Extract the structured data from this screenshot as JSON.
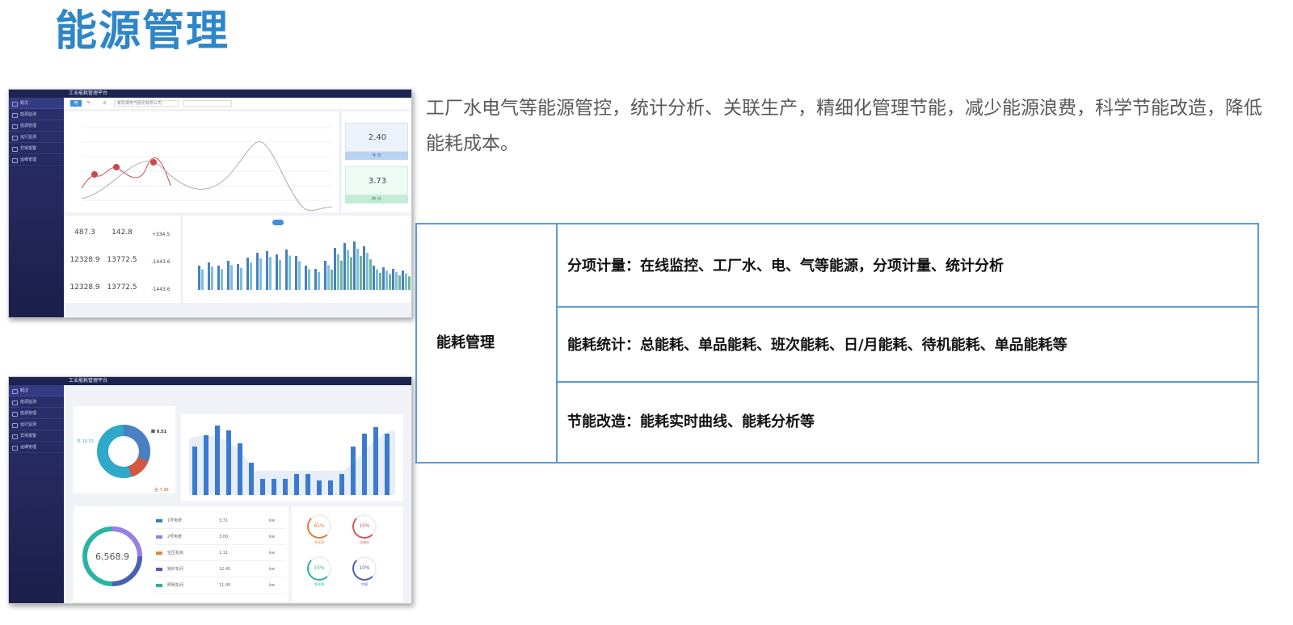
{
  "page": {
    "title": "能源管理",
    "intro": "工厂水电气等能源管控，统计分析、关联生产，精细化管理节能，减少能源浪费，科学节能改造，降低能耗成本。"
  },
  "table": {
    "category": "能耗管理",
    "rows": [
      "分项计量：在线监控、工厂水、电、气等能源，分项计量、统计分析",
      "能耗统计：总能耗、单品能耗、班次能耗、日/月能耗、待机能耗、单品能耗等",
      "节能改造：能耗实时曲线、能耗分析等"
    ]
  },
  "screenshot1": {
    "app_title": "工业能耗管理平台",
    "sidebar": [
      "概况",
      "能源监测",
      "能源管理",
      "运行监测",
      "异常报警",
      "运维管理"
    ],
    "tabs": [
      "电",
      "气",
      "水"
    ],
    "company_select": "某机械电气股份有限公司",
    "kpi_side": [
      {
        "value": "2.40",
        "label": "今 日"
      },
      {
        "value": "3.73",
        "label": "昨 日"
      }
    ],
    "kpis": [
      {
        "value": "487.3"
      },
      {
        "value": "142.8"
      },
      {
        "value": "+334.5"
      },
      {
        "value": "12328.9"
      },
      {
        "value": "13772.5"
      },
      {
        "value": "-1443.6"
      },
      {
        "value": "12328.9"
      },
      {
        "value": "13772.5"
      },
      {
        "value": "-1443.6"
      }
    ],
    "bar_colors": [
      "#4a7fc1",
      "#7ac0dc",
      "#6db58f"
    ],
    "line_color": "#c94a4a",
    "line2_color": "#b9a9a9"
  },
  "screenshot2": {
    "app_title": "工业能耗管理平台",
    "sidebar": [
      "概况",
      "能源监测",
      "能源管理",
      "运行监测",
      "异常报警",
      "运维管理"
    ],
    "donut_labels": [
      "峰 0.51",
      "平 10.51",
      "谷 7.96"
    ],
    "gauge_total": "6,568.9",
    "legend": [
      {
        "name": "1号电表",
        "value": "3.31",
        "unit": "kw",
        "color": "#2f7fc4"
      },
      {
        "name": "2号电表",
        "value": "3.00",
        "unit": "kw",
        "color": "#9a7fe0"
      },
      {
        "name": "空压机房",
        "value": "1.11",
        "unit": "kw",
        "color": "#e0893a"
      },
      {
        "name": "锅炉车间",
        "value": "12.45",
        "unit": "kw",
        "color": "#4a60b0"
      },
      {
        "name": "照明车间",
        "value": "11.00",
        "unit": "kw",
        "color": "#2ab3a0"
      }
    ],
    "rings": [
      {
        "value": "65%",
        "label": "空压机",
        "color": "#e07c3a"
      },
      {
        "value": "10%",
        "label": "注塑机",
        "color": "#d15a5a"
      },
      {
        "value": "15%",
        "label": "喷涂线",
        "color": "#2ab3a0"
      },
      {
        "value": "10%",
        "label": "空调",
        "color": "#4a60b0"
      }
    ]
  }
}
